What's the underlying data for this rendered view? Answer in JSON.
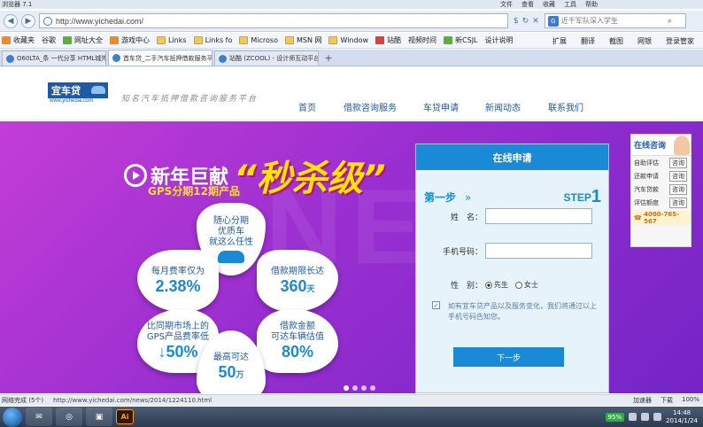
{
  "browser": {
    "title": "浏览器 7.1",
    "menus": [
      "文件",
      "查看",
      "收藏",
      "工具",
      "帮助"
    ],
    "url": "http://www.yichedai.com/",
    "search_placeholder": "近千军队深入学生",
    "bookmarks": [
      {
        "label": "收藏夹",
        "icon": "orange"
      },
      {
        "label": "谷歌",
        "icon": "page"
      },
      {
        "label": "网址大全",
        "icon": "green"
      },
      {
        "label": "游戏中心",
        "icon": "orange"
      },
      {
        "label": "Links",
        "icon": "folder"
      },
      {
        "label": "Links fo",
        "icon": "folder"
      },
      {
        "label": "Microso",
        "icon": "folder"
      },
      {
        "label": "MSN 网",
        "icon": "folder"
      },
      {
        "label": "Window",
        "icon": "folder"
      },
      {
        "label": "站酷",
        "icon": "red"
      },
      {
        "label": "视频时间",
        "icon": "page"
      },
      {
        "label": "新CSJL",
        "icon": "green"
      },
      {
        "label": "设计说明",
        "icon": "page"
      }
    ],
    "bookmark_tools": [
      "扩展",
      "翻译",
      "截图",
      "网银",
      "登录管家"
    ],
    "tabs": [
      {
        "label": "O60LTA_条 一代分享 HTML城外",
        "active": false
      },
      {
        "label": "首车贷_二手汽车抵押借款服务平台",
        "active": true
      },
      {
        "label": "站酷 (ZCOOL) - 设计师互动平台",
        "active": false
      }
    ],
    "status_left": "网络完成 (5个)",
    "status_url": "http://www.yichedai.com/news/2014/1224110.html",
    "status_tools": [
      "加速器",
      "下载",
      "100%"
    ]
  },
  "site": {
    "logo_text": "宜车贷",
    "logo_url": "www.yichedai.com",
    "slogan": "知名汽车抵押借款咨询服务平台",
    "nav": [
      {
        "label": "首页",
        "active": true
      },
      {
        "label": "借款咨询服务",
        "active": false
      },
      {
        "label": "车贷申请",
        "active": false
      },
      {
        "label": "新闻动态",
        "active": false
      },
      {
        "label": "联系我们",
        "active": false
      }
    ]
  },
  "banner": {
    "headline_white": "新年巨献",
    "headline_yellow": "“秒杀级”",
    "subheadline": "GPS分期12期产品",
    "petals": {
      "top": {
        "lines": [
          "随心分期",
          "优质车",
          "就这么任性"
        ]
      },
      "tl": {
        "label": "每月费率仅为",
        "value": "2.38%"
      },
      "tr": {
        "label": "借款期限长达",
        "value": "360",
        "unit": "天"
      },
      "bl": {
        "lines": [
          "比同期市场上的",
          "GPS产品费率低"
        ],
        "value": "↓50%"
      },
      "br": {
        "lines": [
          "借款金额",
          "可达车辆估值"
        ],
        "value": "80%"
      },
      "bot": {
        "label": "最高可达",
        "value": "50",
        "unit": "万"
      }
    },
    "slide_count": 4,
    "active_slide": 0
  },
  "form": {
    "title": "在线申请",
    "step_label": "第一步",
    "step_arrow": "»",
    "step_en": "STEP",
    "step_num": "1",
    "name_label": "姓　名：",
    "phone_label": "手机号码：",
    "gender_label": "性　别：",
    "gender_options": [
      {
        "label": "先生",
        "selected": true
      },
      {
        "label": "女士",
        "selected": false
      }
    ],
    "agree_text": "如有宜车贷产品以及服务变化，我们将通过以上手机号码告知您。",
    "agree_checked": true,
    "submit_label": "下一步"
  },
  "consult": {
    "title": "在线咨询",
    "rows": [
      {
        "label": "自助评估",
        "btn": "咨询"
      },
      {
        "label": "还款申请",
        "btn": "咨询"
      },
      {
        "label": "汽车贷款",
        "btn": "咨询"
      },
      {
        "label": "评估额度",
        "btn": "咨询"
      }
    ],
    "phone": "4000-765-567"
  },
  "taskbar": {
    "battery": "95%",
    "time": "14:48",
    "date": "2014/1/24"
  }
}
